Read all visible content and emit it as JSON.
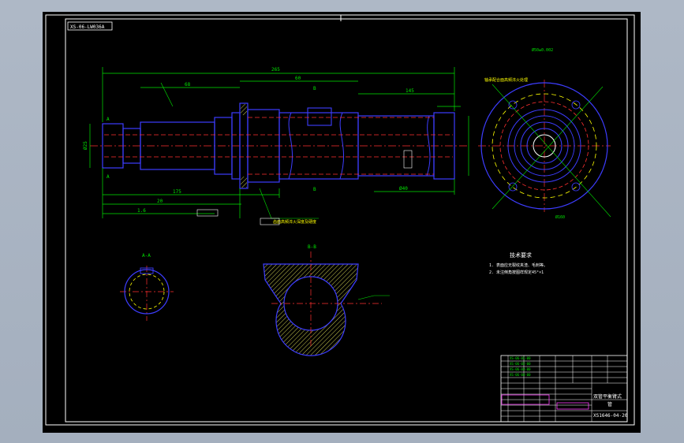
{
  "drawing": {
    "frame_tag": "XS-06-LW036A",
    "section_aa": "A-A",
    "section_bb": "B-B",
    "section_left_a": "A",
    "section_left_a2": "A",
    "view_b_top": "B",
    "view_b_bottom": "B",
    "tech_title": "技术要求",
    "tech_req_1": "1.  表面应无裂纹夹渣、毛刺等。",
    "tech_req_2": "2.  未注倒角按图样规定45°×1",
    "callout_quench": "齿面高频淬火深度及硬度",
    "callout_note": "轴承配合面高频淬火处理",
    "callout_right": "Ø50±0.002",
    "circle_dim": "Ø160",
    "dim_overall": "265",
    "dim_a": "68",
    "dim_b": "60",
    "dim_c": "145",
    "dim_d": "175",
    "dim_e": "20",
    "dim_f": "1.6",
    "dim_g": "Ø40",
    "dim_h": "Ø25",
    "bom_row1": "XS-06-01-00",
    "bom_row2": "XS-06-02-00",
    "bom_row3": "XS-06-03-00",
    "bom_row4": "XS-06-04-00",
    "title_name": "双管平衡臂式",
    "title_sub": "管",
    "drawing_no": "XS1646-04-20"
  },
  "colors": {
    "sheet": "#000000",
    "outline": "#3d3dff",
    "dimension": "#00e600",
    "centerline": "#ff3030",
    "hidden": "#ffff00",
    "hatch": "#ffff66",
    "magenta": "#ff40ff",
    "white": "#ffffff",
    "cyan": "#00ffff"
  }
}
